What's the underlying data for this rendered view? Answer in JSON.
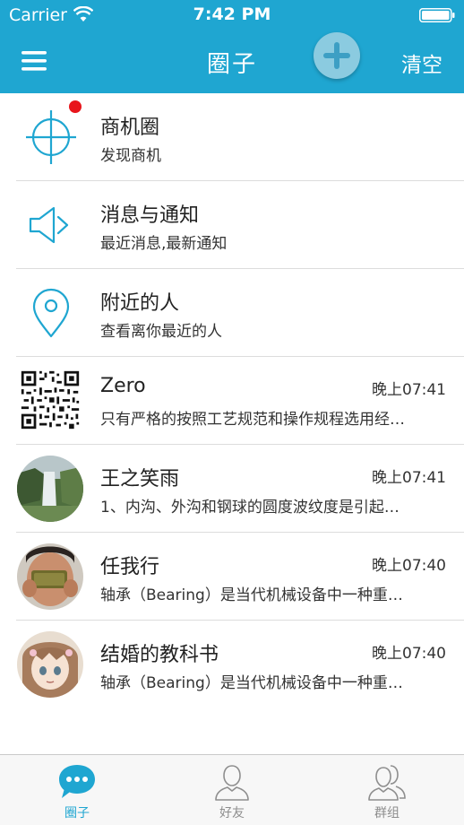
{
  "status_bar": {
    "carrier": "Carrier",
    "time": "7:42 PM"
  },
  "nav": {
    "title": "圈子",
    "clear_label": "清空"
  },
  "colors": {
    "primary": "#1fa6d1",
    "badge": "#e8151b",
    "add_button": "#8bcbe0"
  },
  "feature_items": [
    {
      "title": "商机圈",
      "subtitle": "发现商机",
      "icon": "crosshair-icon",
      "has_badge": true
    },
    {
      "title": "消息与通知",
      "subtitle": "最近消息,最新通知",
      "icon": "speaker-icon"
    },
    {
      "title": "附近的人",
      "subtitle": "查看离你最近的人",
      "icon": "location-pin-icon"
    }
  ],
  "conversations": [
    {
      "name": "Zero",
      "time": "晚上07:41",
      "preview": "只有严格的按照工艺规范和操作规程选用经…",
      "avatar": "qr-code-avatar"
    },
    {
      "name": "王之笑雨",
      "time": "晚上07:41",
      "preview": " 1、内沟、外沟和钢球的圆度波纹度是引起…",
      "avatar": "waterfall-avatar"
    },
    {
      "name": "任我行",
      "time": "晚上07:40",
      "preview": "轴承（Bearing）是当代机械设备中一种重…",
      "avatar": "person-photo-avatar"
    },
    {
      "name": "结婚的教科书",
      "time": "晚上07:40",
      "preview": "轴承（Bearing）是当代机械设备中一种重…",
      "avatar": "anime-girl-avatar"
    }
  ],
  "tabs": [
    {
      "label": "圈子",
      "icon": "chat-bubble-icon",
      "active": true
    },
    {
      "label": "好友",
      "icon": "person-icon",
      "active": false
    },
    {
      "label": "群组",
      "icon": "group-icon",
      "active": false
    }
  ]
}
